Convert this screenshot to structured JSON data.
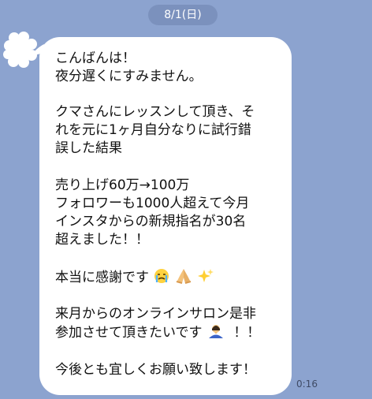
{
  "date_separator": "8/1(日)",
  "message": {
    "lines": [
      "こんばんは！",
      "夜分遅くにすみません。",
      "クマさんにレッスンして頂き、そ",
      "れを元に1ヶ月自分なりに試行錯",
      "誤した結果",
      "売り上げ60万→100万",
      "フォロワーも1000人超えて今月",
      "インスタからの新規指名が30名",
      "超えました！！",
      "本当に感謝です",
      "来月からのオンラインサロン是非",
      "参加させて頂きたいです",
      "！！",
      "今後とも宜しくお願い致します！"
    ],
    "time": "0:16"
  },
  "icons": {
    "avatar": "white-cloud-avatar-icon",
    "emoji_1": "crying-face-icon",
    "emoji_2": "folded-hands-icon",
    "emoji_3": "sparkles-icon",
    "emoji_4": "bowing-person-icon"
  },
  "colors": {
    "background": "#8ca3cf",
    "date_pill": "#7b91bd",
    "bubble": "#ffffff",
    "text": "#111111"
  }
}
